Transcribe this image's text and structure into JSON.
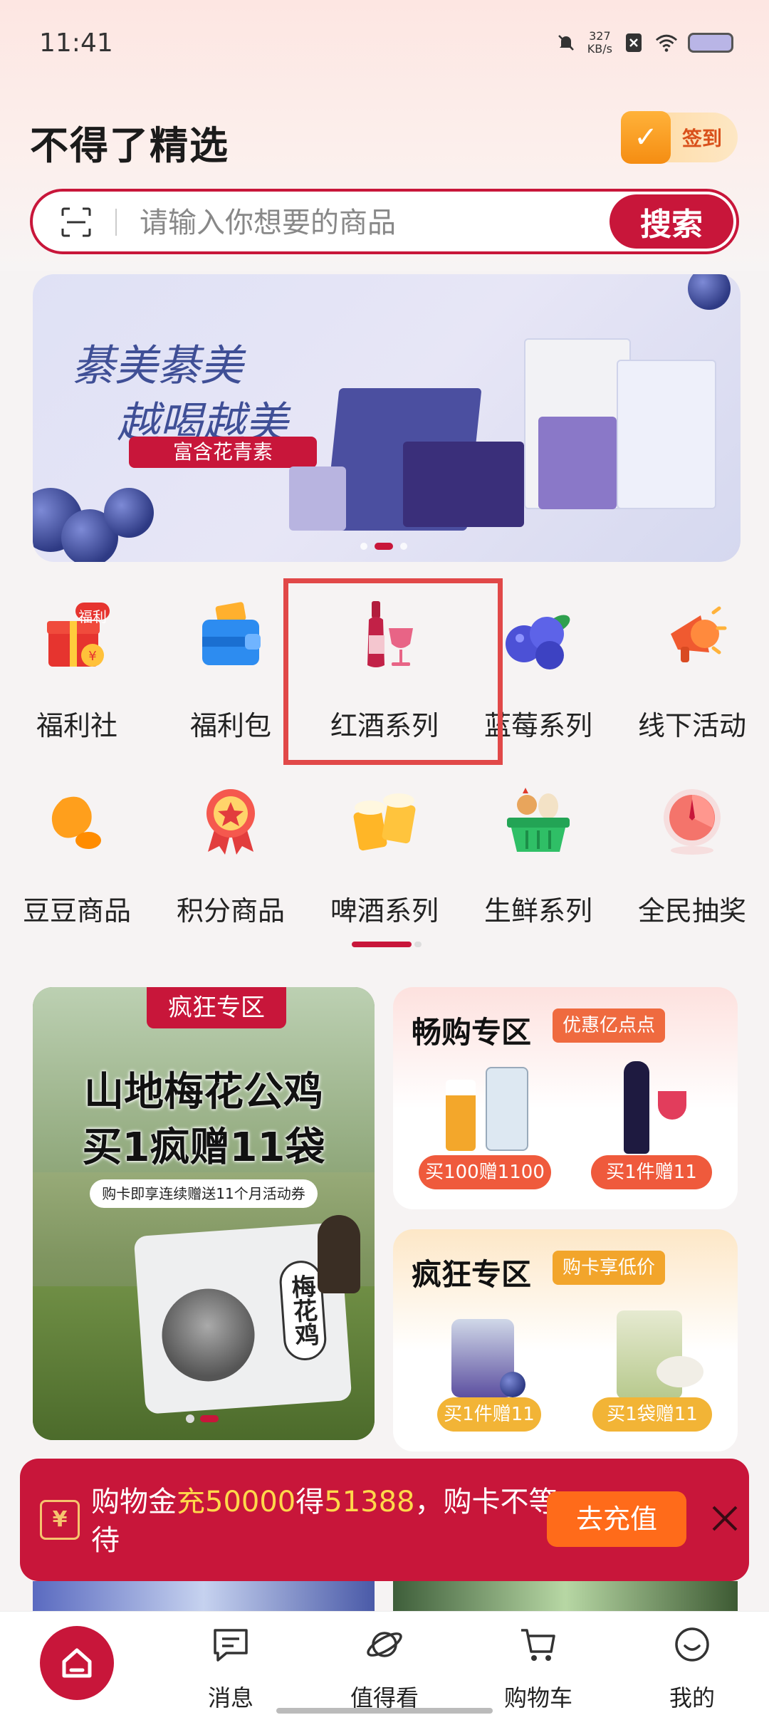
{
  "status": {
    "time": "11:41",
    "net_speed_value": "327",
    "net_speed_unit": "KB/s"
  },
  "header": {
    "title": "不得了精选",
    "signin_label": "签到"
  },
  "search": {
    "placeholder": "请输入你想要的商品",
    "button_label": "搜索"
  },
  "banner": {
    "line1": "綦美綦美",
    "line2": "越喝越美",
    "tag": "富含花青素",
    "active_index": 1,
    "count": 3
  },
  "categories": [
    {
      "label": "福利社",
      "icon": "gift-box-icon",
      "badge": "福利"
    },
    {
      "label": "福利包",
      "icon": "wallet-icon"
    },
    {
      "label": "红酒系列",
      "icon": "wine-bottle-icon"
    },
    {
      "label": "蓝莓系列",
      "icon": "blueberry-icon"
    },
    {
      "label": "线下活动",
      "icon": "megaphone-icon"
    },
    {
      "label": "豆豆商品",
      "icon": "bean-icon"
    },
    {
      "label": "积分商品",
      "icon": "medal-icon"
    },
    {
      "label": "啤酒系列",
      "icon": "beer-mugs-icon"
    },
    {
      "label": "生鲜系列",
      "icon": "fresh-basket-icon"
    },
    {
      "label": "全民抽奖",
      "icon": "lottery-wheel-icon"
    }
  ],
  "promo_left": {
    "tag": "疯狂专区",
    "line1": "山地梅花公鸡",
    "line2": "买1疯赠11袋",
    "sub": "购卡即享连续赠送11个月活动券",
    "bag_label": "梅花鸡"
  },
  "promo_a": {
    "title": "畅购专区",
    "badge": "优惠亿点点",
    "offer_left": "买100赠1100",
    "offer_right": "买1件赠11"
  },
  "promo_b": {
    "title": "疯狂专区",
    "badge": "购卡享低价",
    "offer_left": "买1件赠11",
    "offer_right": "买1袋赠11"
  },
  "recharge": {
    "text_a": "购物金",
    "text_b": "充50000",
    "text_c": "得",
    "text_d": "51388",
    "text_e": "，购卡不等待",
    "button_label": "去充值"
  },
  "tabbar": [
    {
      "label": "",
      "icon": "home-icon"
    },
    {
      "label": "消息",
      "icon": "message-icon"
    },
    {
      "label": "值得看",
      "icon": "planet-icon"
    },
    {
      "label": "购物车",
      "icon": "cart-icon"
    },
    {
      "label": "我的",
      "icon": "smile-face-icon"
    }
  ],
  "colors": {
    "brand": "#c8163a",
    "highlight": "#e14848",
    "accent_orange": "#ff6b1a",
    "accent_yellow": "#ffd94b"
  }
}
